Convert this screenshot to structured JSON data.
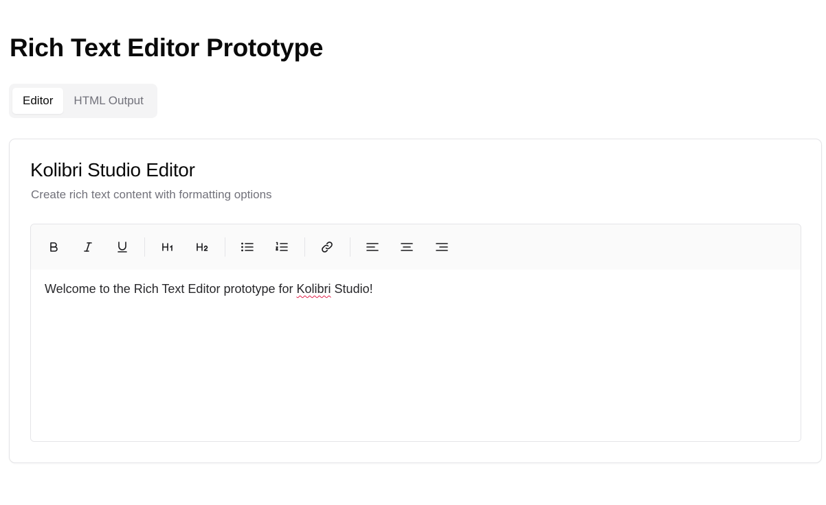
{
  "page": {
    "title": "Rich Text Editor Prototype"
  },
  "tabs": [
    {
      "label": "Editor",
      "active": true
    },
    {
      "label": "HTML Output",
      "active": false
    }
  ],
  "card": {
    "title": "Kolibri Studio Editor",
    "subtitle": "Create rich text content with formatting options"
  },
  "toolbar": {
    "buttons": [
      {
        "name": "bold-icon",
        "group": "text-style"
      },
      {
        "name": "italic-icon",
        "group": "text-style"
      },
      {
        "name": "underline-icon",
        "group": "text-style"
      },
      {
        "name": "heading-1-icon",
        "group": "headings"
      },
      {
        "name": "heading-2-icon",
        "group": "headings"
      },
      {
        "name": "bullet-list-icon",
        "group": "lists"
      },
      {
        "name": "numbered-list-icon",
        "group": "lists"
      },
      {
        "name": "link-icon",
        "group": "link"
      },
      {
        "name": "align-left-icon",
        "group": "alignment"
      },
      {
        "name": "align-center-icon",
        "group": "alignment"
      },
      {
        "name": "align-right-icon",
        "group": "alignment"
      }
    ]
  },
  "editor": {
    "text_before": "Welcome to the Rich Text Editor prototype for ",
    "misspelled_word": "Kolibri",
    "text_after": " Studio!"
  },
  "colors": {
    "muted_text": "#71717a",
    "border": "#e4e4e7",
    "toolbar_bg": "#fafafa",
    "tab_bg": "#f4f4f5",
    "spellcheck": "#e11d48"
  }
}
